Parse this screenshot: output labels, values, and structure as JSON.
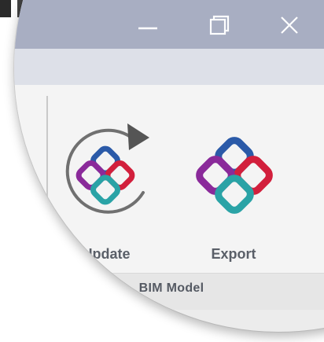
{
  "window": {
    "controls": [
      "minimize-icon",
      "maximize-icon",
      "close-icon"
    ]
  },
  "ribbon": {
    "buttons": [
      {
        "label": "Update",
        "icon": "ifc-update-icon"
      },
      {
        "label": "Export",
        "icon": "ifc-logo-icon"
      }
    ],
    "group_label": "BIM Model"
  },
  "colors": {
    "titlebar": "#a8aec2",
    "ifc_blue": "#2b5aa8",
    "ifc_red": "#d21f3c",
    "ifc_purple": "#8a2a9a",
    "ifc_teal": "#2aa3a6",
    "label_text": "#5a5f68"
  }
}
